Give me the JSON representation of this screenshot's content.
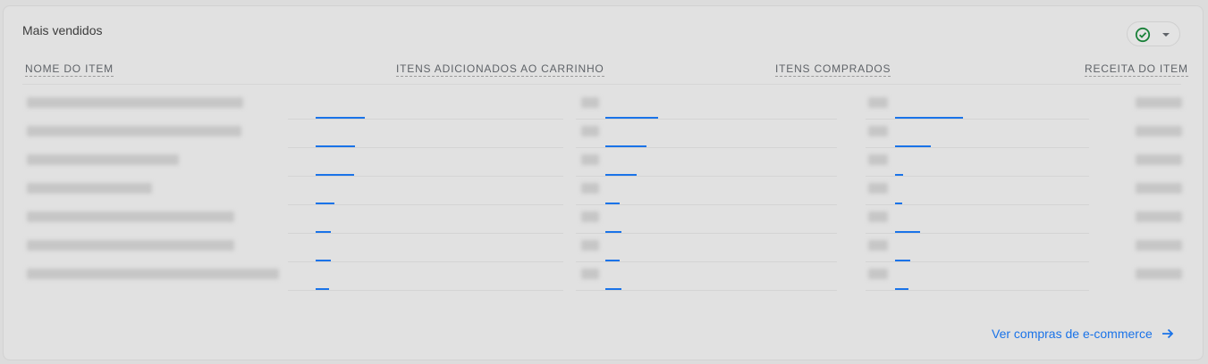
{
  "card": {
    "title": "Mais vendidos",
    "status_icon": "check-circle-icon",
    "status_color": "#188038",
    "dropdown_icon": "caret-down-icon"
  },
  "table": {
    "columns": [
      "NOME DO ITEM",
      "ITENS ADICIONADOS AO CARRINHO",
      "ITENS COMPRADOS",
      "RECEITA DO ITEM"
    ],
    "row_count": 7,
    "relative_levels": {
      "itens_adicionados_ao_carrinho": [
        1.0,
        0.8,
        0.78,
        0.38,
        0.3,
        0.3,
        0.28
      ],
      "itens_comprados": [
        1.0,
        0.78,
        0.6,
        0.27,
        0.3,
        0.27,
        0.3
      ],
      "receita_do_item": [
        1.0,
        0.52,
        0.12,
        0.05,
        0.37,
        0.22,
        0.2
      ]
    },
    "bar_color": "#1a73e8",
    "values_obscured": true
  },
  "footer": {
    "link_label": "Ver compras de e-commerce",
    "link_icon": "arrow-right-icon"
  }
}
